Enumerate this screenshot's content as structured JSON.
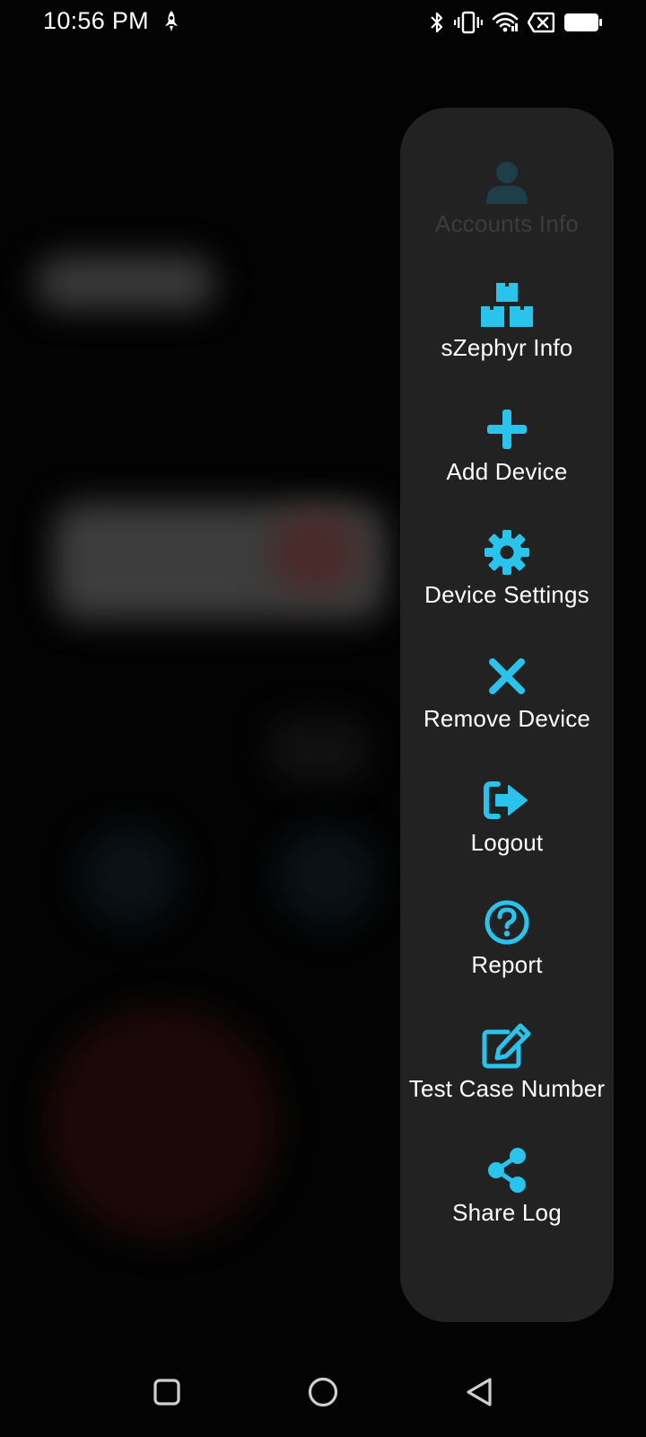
{
  "status_bar": {
    "time": "10:56 PM",
    "left_icon": "rocket-icon",
    "right_icons": [
      "bluetooth-icon",
      "vibrate-icon",
      "wifi-icon",
      "battery-x-icon",
      "battery-icon"
    ]
  },
  "colors": {
    "accent": "#29c3ec",
    "menu_bg": "#222222",
    "disabled": "#3c3c3c"
  },
  "menu": {
    "items": [
      {
        "label": "Accounts Info",
        "icon": "user-icon",
        "enabled": false
      },
      {
        "label": "sZephyr Info",
        "icon": "boxes-icon",
        "enabled": true
      },
      {
        "label": "Add Device",
        "icon": "plus-icon",
        "enabled": true
      },
      {
        "label": "Device Settings",
        "icon": "gear-icon",
        "enabled": true
      },
      {
        "label": "Remove Device",
        "icon": "close-icon",
        "enabled": true
      },
      {
        "label": "Logout",
        "icon": "logout-icon",
        "enabled": true
      },
      {
        "label": "Report",
        "icon": "question-icon",
        "enabled": true
      },
      {
        "label": "Test Case Number",
        "icon": "edit-icon",
        "enabled": true
      },
      {
        "label": "Share Log",
        "icon": "share-icon",
        "enabled": true
      }
    ]
  },
  "nav_bar": {
    "buttons": [
      "recents-icon",
      "home-icon",
      "back-icon"
    ]
  }
}
